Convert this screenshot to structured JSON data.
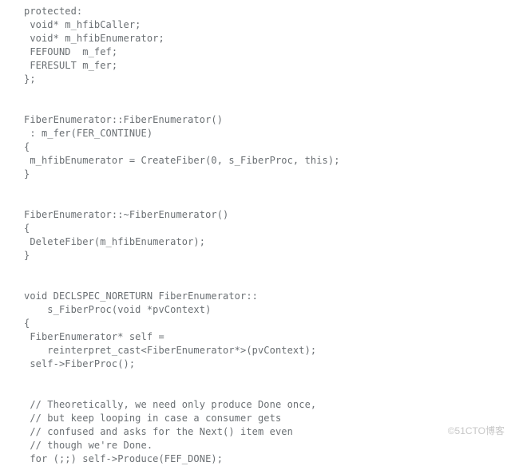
{
  "code": "protected:\n void* m_hfibCaller;\n void* m_hfibEnumerator;\n FEFOUND  m_fef;\n FERESULT m_fer;\n};\n\n\nFiberEnumerator::FiberEnumerator()\n : m_fer(FER_CONTINUE)\n{\n m_hfibEnumerator = CreateFiber(0, s_FiberProc, this);\n}\n\n\nFiberEnumerator::~FiberEnumerator()\n{\n DeleteFiber(m_hfibEnumerator);\n}\n\n\nvoid DECLSPEC_NORETURN FiberEnumerator::\n    s_FiberProc(void *pvContext)\n{\n FiberEnumerator* self =\n    reinterpret_cast<FiberEnumerator*>(pvContext);\n self->FiberProc();\n\n\n // Theoretically, we need only produce Done once,\n // but keep looping in case a consumer gets\n // confused and asks for the Next() item even\n // though we're Done.\n for (;;) self->Produce(FEF_DONE);",
  "watermark": "©51CTO博客"
}
